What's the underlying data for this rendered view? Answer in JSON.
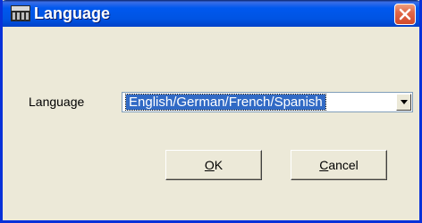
{
  "window": {
    "title": "Language",
    "app_icon": "dme-app-icon",
    "close_icon": "close-icon"
  },
  "form": {
    "language_label": "Language",
    "language_selected": "English/German/French/Spanish"
  },
  "buttons": {
    "ok_mnemonic": "O",
    "ok_rest": "K",
    "cancel_mnemonic": "C",
    "cancel_rest": "ancel"
  },
  "colors": {
    "titlebar": "#0054e3",
    "selection": "#316ac5",
    "dialog_bg": "#ece9d8",
    "close_button": "#d14a2c"
  }
}
